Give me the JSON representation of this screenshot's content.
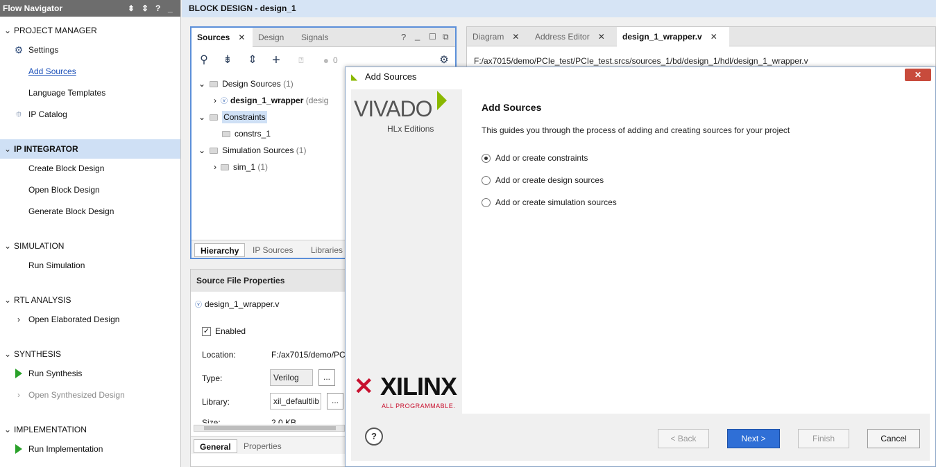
{
  "flow_navigator": {
    "title": "Flow Navigator",
    "sections": [
      {
        "label": "PROJECT MANAGER",
        "items": [
          {
            "label": "Settings",
            "icon": "gear-icon"
          },
          {
            "label": "Add Sources",
            "link": true
          },
          {
            "label": "Language Templates"
          },
          {
            "label": "IP Catalog",
            "icon": "ip-plug-icon"
          }
        ]
      },
      {
        "label": "IP INTEGRATOR",
        "selected": true,
        "items": [
          {
            "label": "Create Block Design"
          },
          {
            "label": "Open Block Design"
          },
          {
            "label": "Generate Block Design"
          }
        ]
      },
      {
        "label": "SIMULATION",
        "items": [
          {
            "label": "Run Simulation"
          }
        ]
      },
      {
        "label": "RTL ANALYSIS",
        "items": [
          {
            "label": "Open Elaborated Design",
            "expandable": true
          }
        ]
      },
      {
        "label": "SYNTHESIS",
        "items": [
          {
            "label": "Run Synthesis",
            "icon": "run-icon"
          },
          {
            "label": "Open Synthesized Design",
            "expandable": true,
            "disabled": true
          }
        ]
      },
      {
        "label": "IMPLEMENTATION",
        "items": [
          {
            "label": "Run Implementation",
            "icon": "run-icon"
          }
        ]
      }
    ]
  },
  "block_design": {
    "title": "BLOCK DESIGN - design_1"
  },
  "sources_panel": {
    "tabs": [
      "Sources",
      "Design",
      "Signals"
    ],
    "status_count": "0",
    "tree": {
      "design_sources": {
        "label": "Design Sources",
        "count": "(1)"
      },
      "wrapper": {
        "label": "design_1_wrapper",
        "suffix": "(desig"
      },
      "constraints": {
        "label": "Constraints"
      },
      "constrs": {
        "label": "constrs_1"
      },
      "sim_sources": {
        "label": "Simulation Sources",
        "count": "(1)"
      },
      "sim": {
        "label": "sim_1",
        "count": "(1)"
      }
    },
    "bottom_tabs": [
      "Hierarchy",
      "IP Sources",
      "Libraries"
    ]
  },
  "properties": {
    "title": "Source File Properties",
    "file": "design_1_wrapper.v",
    "enabled_label": "Enabled",
    "location_label": "Location:",
    "location_value": "F:/ax7015/demo/PC",
    "type_label": "Type:",
    "type_value": "Verilog",
    "library_label": "Library:",
    "library_value": "xil_defaultlib",
    "size_label": "Size:",
    "size_value": "2.0 KB",
    "dots": "...",
    "bottom_tabs": [
      "General",
      "Properties"
    ]
  },
  "editor": {
    "tabs": [
      "Diagram",
      "Address Editor",
      "design_1_wrapper.v"
    ],
    "path": "F:/ax7015/demo/PCIe_test/PCIe_test.srcs/sources_1/bd/design_1/hdl/design_1_wrapper.v"
  },
  "dialog": {
    "title": "Add Sources",
    "brand_vivado": "VIVADO",
    "brand_hlx": "HLx Editions",
    "brand_xilinx": "XILINX",
    "brand_tagline": "ALL PROGRAMMABLE.",
    "heading": "Add Sources",
    "description": "This guides you through the process of adding and creating sources for your project",
    "options": [
      {
        "label": "Add or create constraints",
        "selected": true
      },
      {
        "label": "Add or create design sources",
        "selected": false
      },
      {
        "label": "Add or create simulation sources",
        "selected": false
      }
    ],
    "help": "?",
    "buttons": {
      "back": "< Back",
      "next": "Next >",
      "finish": "Finish",
      "cancel": "Cancel"
    },
    "colors": {
      "primary": "#2f6fd6",
      "accent": "#8ab800",
      "xilinx_red": "#c8102e"
    }
  }
}
